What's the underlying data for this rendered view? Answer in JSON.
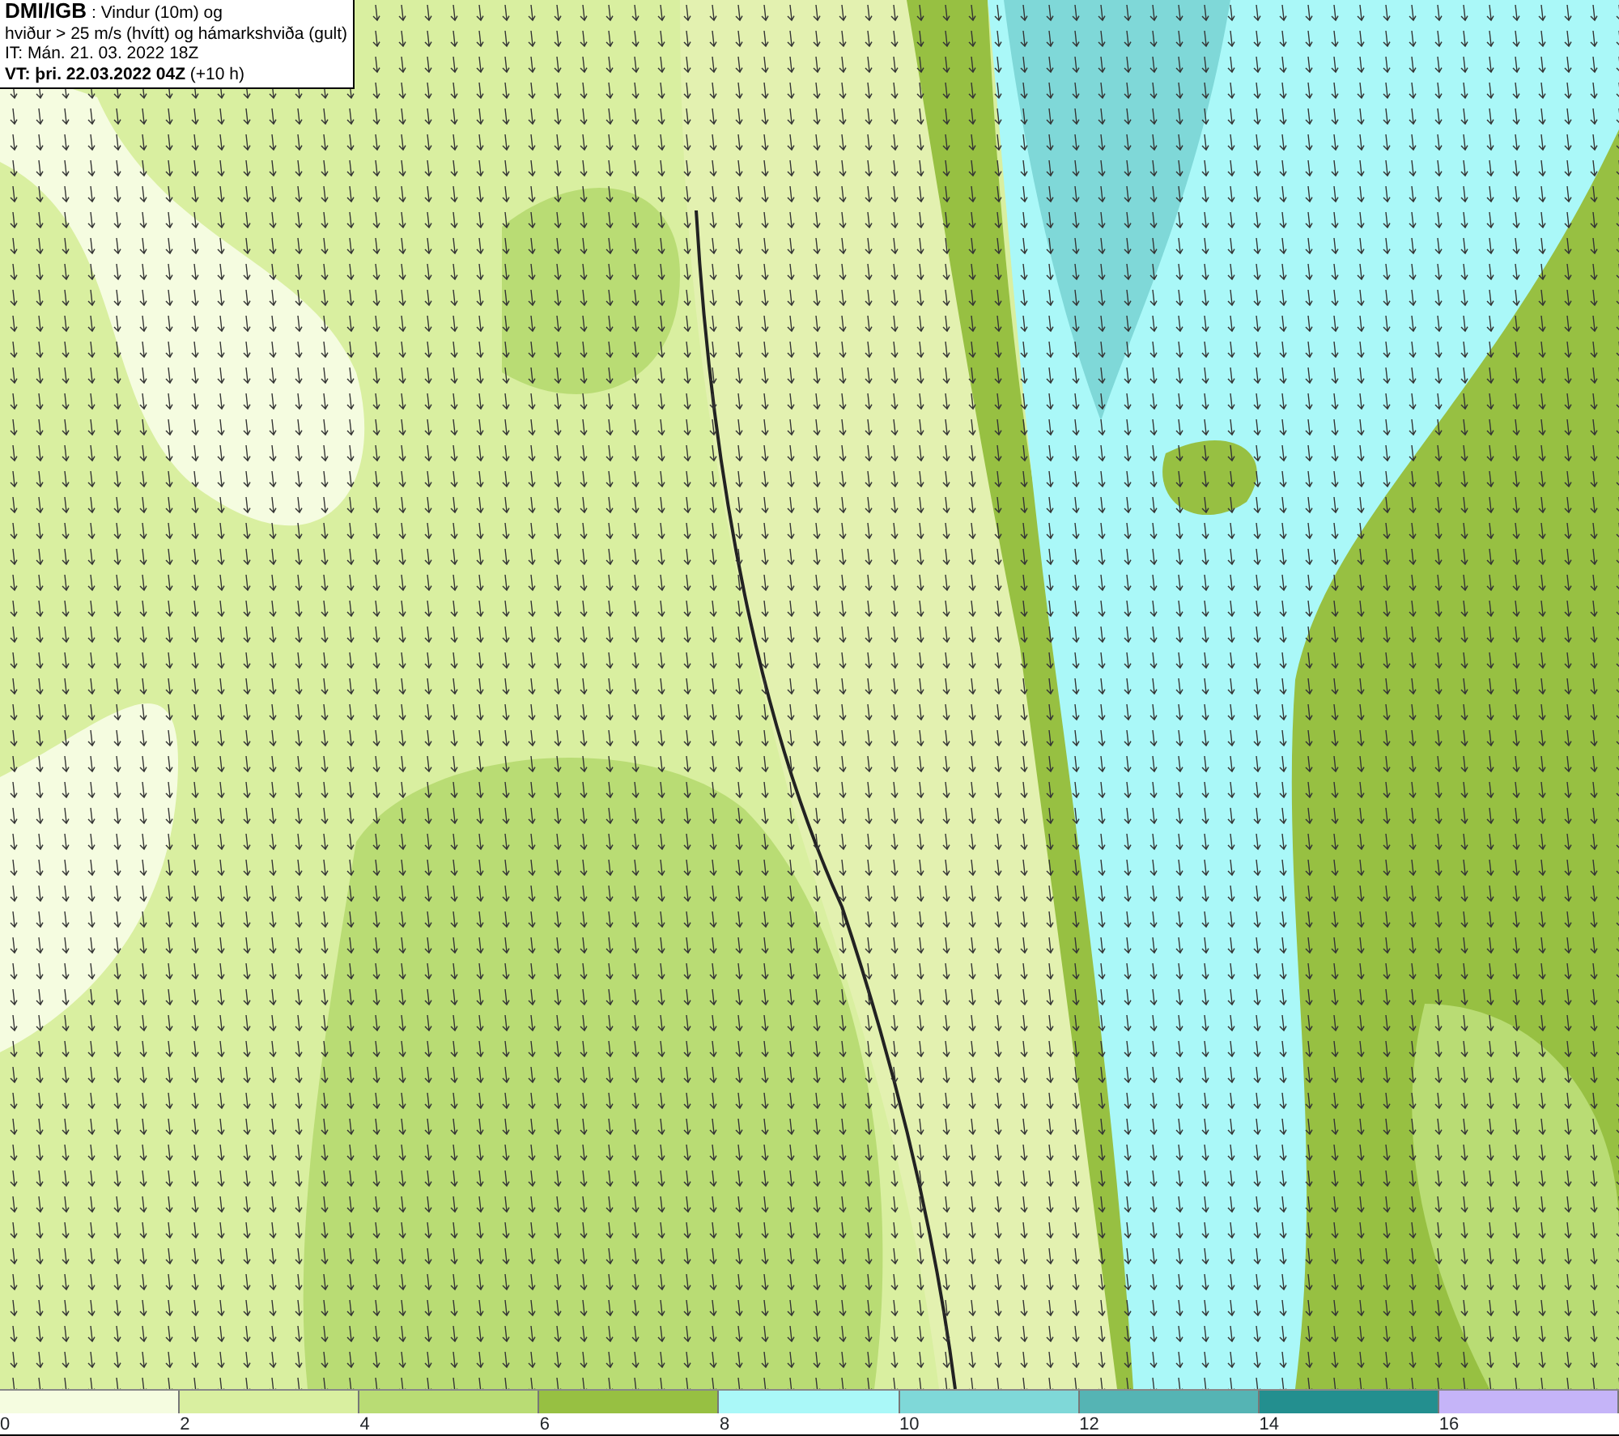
{
  "title_box": {
    "lines": [
      "**DMI/IGB** : Vindur (10m) og",
      "hviður > 25 m/s (hvítt) og hámarkshviða (gult)",
      "IT: Mán. 21. 03. 2022 18Z",
      "**VT: þri. 22.03.2022 04Z** (+10 h)"
    ]
  },
  "legend": {
    "bands": [
      {
        "color": "#f5fce0"
      },
      {
        "color": "#d9efa0"
      },
      {
        "color": "#b9dc74"
      },
      {
        "color": "#97c042"
      },
      {
        "color": "#aaf8f8"
      },
      {
        "color": "#7fd8d8"
      },
      {
        "color": "#55b4b4"
      },
      {
        "color": "#238f8f"
      },
      {
        "color": "#c5b4f8"
      }
    ],
    "ticks": [
      "0",
      "2",
      "4",
      "6",
      "8",
      "10",
      "12",
      "14",
      "16"
    ]
  }
}
